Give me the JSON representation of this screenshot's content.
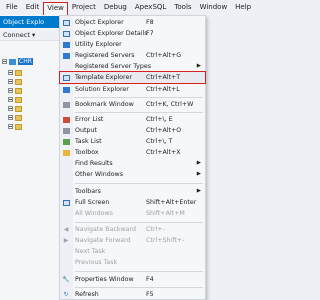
{
  "menubar": [
    "File",
    "Edit",
    "View",
    "Project",
    "Debug",
    "ApexSQL",
    "Tools",
    "Window",
    "Help"
  ],
  "object_explorer": {
    "title": "Object Explo",
    "connect": "Connect ▾",
    "root": "CHR"
  },
  "menu": {
    "items": [
      {
        "label": "Object Explorer",
        "shortcut": "F8",
        "icon": "object-explorer-icon"
      },
      {
        "label": "Object Explorer Details",
        "shortcut": "F7",
        "icon": "details-icon"
      },
      {
        "label": "Utility Explorer",
        "shortcut": "",
        "icon": "utility-icon"
      },
      {
        "label": "Registered Servers",
        "shortcut": "Ctrl+Alt+G",
        "icon": "servers-icon"
      },
      {
        "label": "Registered Server Types",
        "shortcut": "",
        "icon": "",
        "submenu": true
      },
      {
        "label": "Template Explorer",
        "shortcut": "Ctrl+Alt+T",
        "icon": "template-icon",
        "highlight": true
      },
      {
        "label": "Solution Explorer",
        "shortcut": "Ctrl+Alt+L",
        "icon": "solution-icon"
      },
      {
        "label": "Bookmark Window",
        "shortcut": "Ctrl+K, Ctrl+W",
        "icon": "bookmark-icon"
      },
      {
        "label": "Error List",
        "shortcut": "Ctrl+\\, E",
        "icon": "error-icon"
      },
      {
        "label": "Output",
        "shortcut": "Ctrl+Alt+O",
        "icon": "output-icon"
      },
      {
        "label": "Task List",
        "shortcut": "Ctrl+\\, T",
        "icon": "task-icon"
      },
      {
        "label": "Toolbox",
        "shortcut": "Ctrl+Alt+X",
        "icon": "toolbox-icon"
      },
      {
        "label": "Find Results",
        "shortcut": "",
        "icon": "",
        "submenu": true
      },
      {
        "label": "Other Windows",
        "shortcut": "",
        "icon": "",
        "submenu": true
      },
      {
        "label": "Toolbars",
        "shortcut": "",
        "icon": "",
        "submenu": true
      },
      {
        "label": "Full Screen",
        "shortcut": "Shift+Alt+Enter",
        "icon": "fullscreen-icon"
      },
      {
        "label": "All Windows",
        "shortcut": "Shift+Alt+M",
        "icon": "",
        "disabled": true
      },
      {
        "label": "Navigate Backward",
        "shortcut": "Ctrl+-",
        "icon": "nav-back-icon",
        "disabled": true
      },
      {
        "label": "Navigate Forward",
        "shortcut": "Ctrl+Shift+-",
        "icon": "nav-forward-icon",
        "disabled": true
      },
      {
        "label": "Next Task",
        "shortcut": "",
        "icon": "",
        "disabled": true
      },
      {
        "label": "Previous Task",
        "shortcut": "",
        "icon": "",
        "disabled": true
      },
      {
        "label": "Properties Window",
        "shortcut": "F4",
        "icon": "wrench-icon"
      },
      {
        "label": "Refresh",
        "shortcut": "F5",
        "icon": "refresh-icon"
      }
    ]
  },
  "colors": {
    "accent": "#007acc",
    "highlight_border": "#d62020"
  }
}
